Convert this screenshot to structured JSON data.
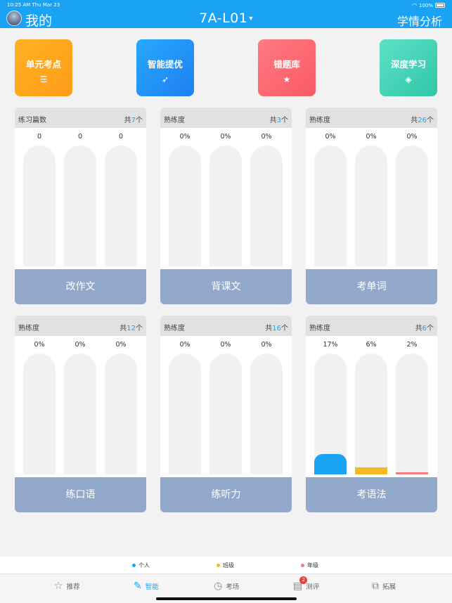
{
  "status_bar": {
    "time": "10:25 AM",
    "date": "Thu Mar 23",
    "battery": "100%"
  },
  "header": {
    "left_title": "我的",
    "center_title": "7A-L01",
    "right_link": "学情分析",
    "caret": "▾"
  },
  "tiles": [
    {
      "label": "单元考点",
      "icon": "list-icon",
      "glyph": "☰",
      "color": "#ffa61d"
    },
    {
      "label": "智能提优",
      "icon": "rocket-icon",
      "glyph": "➶",
      "color": "#2294f8"
    },
    {
      "label": "错题库",
      "icon": "star-icon",
      "glyph": "★",
      "color": "#fa6670"
    },
    {
      "label": "深度学习",
      "icon": "layers-icon",
      "glyph": "◈",
      "color": "#45d4b8"
    }
  ],
  "cards": [
    {
      "label": "练习篇数",
      "total_prefix": "共",
      "total": "7",
      "total_suffix": "个",
      "values": [
        "0",
        "0",
        "0"
      ],
      "fills": [
        0,
        0,
        0
      ],
      "footer": "改作文"
    },
    {
      "label": "熟练度",
      "total_prefix": "共",
      "total": "3",
      "total_suffix": "个",
      "values": [
        "0%",
        "0%",
        "0%"
      ],
      "fills": [
        0,
        0,
        0
      ],
      "footer": "背课文"
    },
    {
      "label": "熟练度",
      "total_prefix": "共",
      "total": "26",
      "total_suffix": "个",
      "values": [
        "0%",
        "0%",
        "0%"
      ],
      "fills": [
        0,
        0,
        0
      ],
      "footer": "考单词"
    },
    {
      "label": "熟练度",
      "total_prefix": "共",
      "total": "12",
      "total_suffix": "个",
      "values": [
        "0%",
        "0%",
        "0%"
      ],
      "fills": [
        0,
        0,
        0
      ],
      "footer": "练口语"
    },
    {
      "label": "熟练度",
      "total_prefix": "共",
      "total": "16",
      "total_suffix": "个",
      "values": [
        "0%",
        "0%",
        "0%"
      ],
      "fills": [
        0,
        0,
        0
      ],
      "footer": "练听力"
    },
    {
      "label": "熟练度",
      "total_prefix": "共",
      "total": "6",
      "total_suffix": "个",
      "values": [
        "17%",
        "6%",
        "2%"
      ],
      "fills": [
        0.17,
        0.06,
        0.02
      ],
      "footer": "考语法"
    }
  ],
  "series_colors": [
    "#1aa3f5",
    "#f7b924",
    "#f27c84"
  ],
  "legend": [
    {
      "label": "个人",
      "color": "#1aa3f5"
    },
    {
      "label": "班级",
      "color": "#f7b924"
    },
    {
      "label": "年级",
      "color": "#f27c84"
    }
  ],
  "tabs": [
    {
      "label": "推荐",
      "icon": "star-outline-icon",
      "glyph": "☆",
      "active": false
    },
    {
      "label": "智能",
      "icon": "pen-circle-icon",
      "glyph": "✎",
      "active": true
    },
    {
      "label": "考场",
      "icon": "clock-icon",
      "glyph": "◷",
      "active": false
    },
    {
      "label": "测评",
      "icon": "clipboard-icon",
      "glyph": "▤",
      "active": false,
      "badge": "2"
    },
    {
      "label": "拓展",
      "icon": "person-board-icon",
      "glyph": "⧉",
      "active": false
    }
  ]
}
